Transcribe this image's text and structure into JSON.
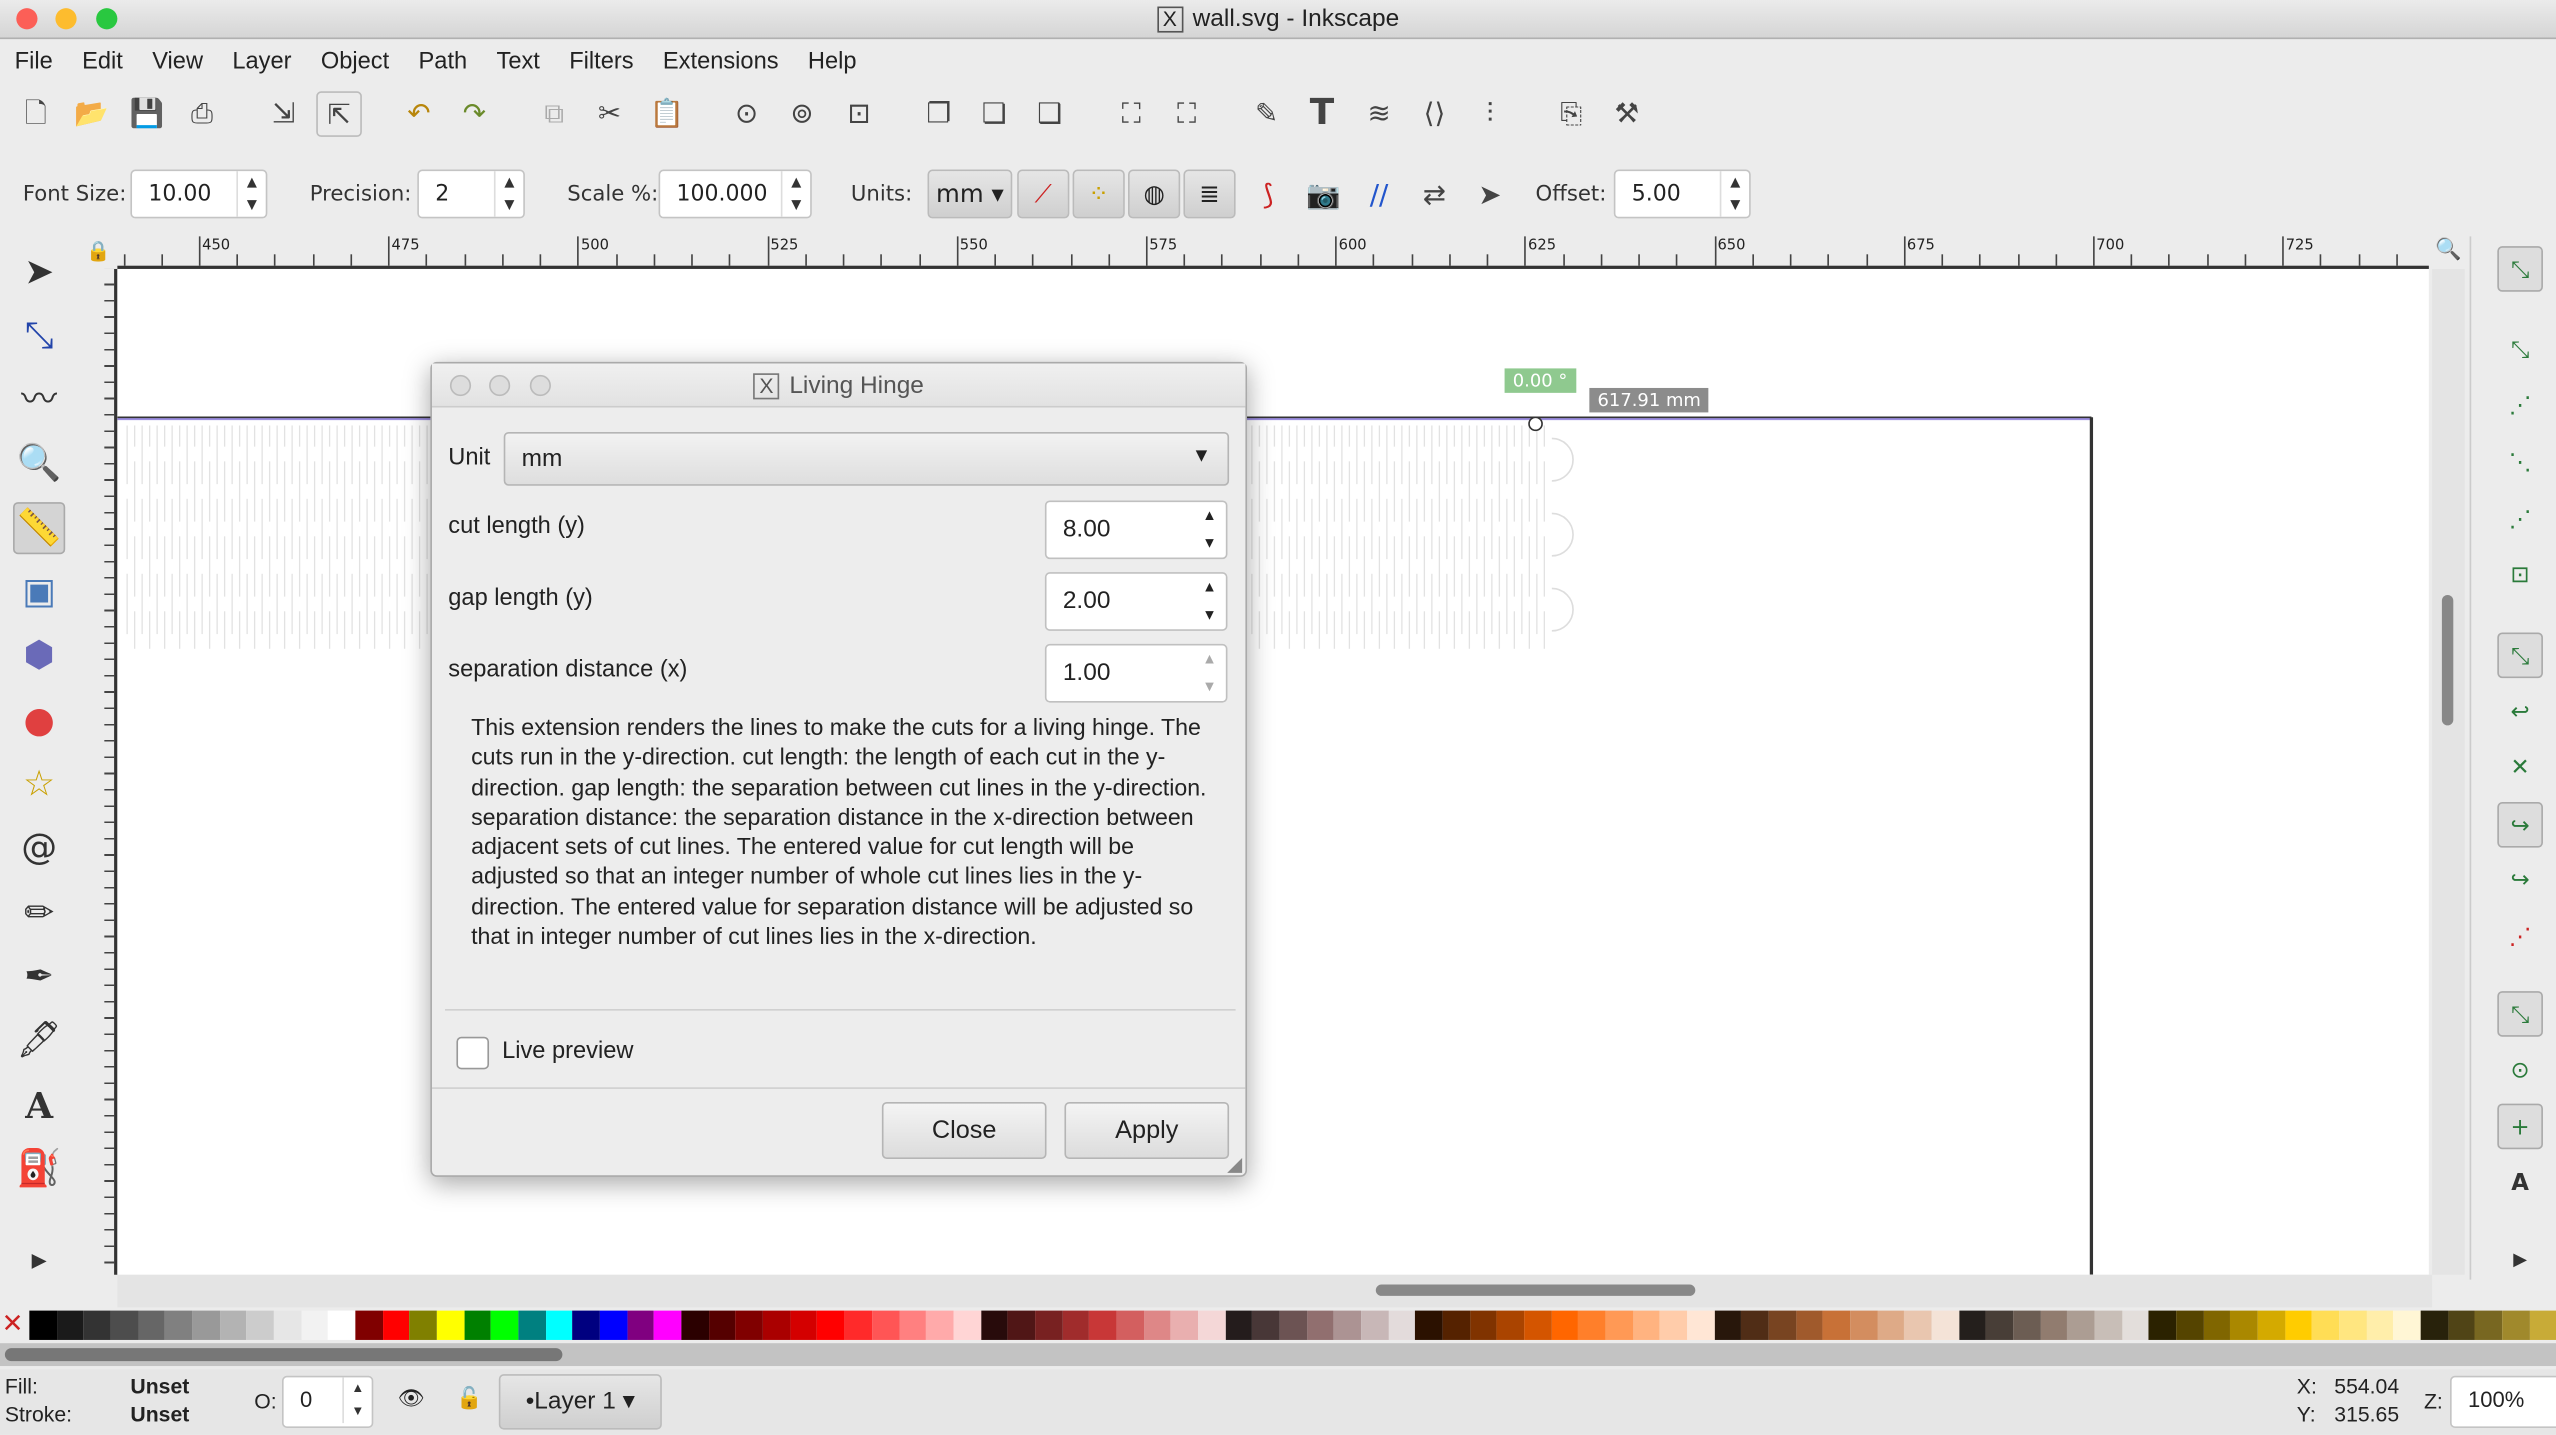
{
  "window": {
    "title": "wall.svg - Inkscape"
  },
  "menu": [
    "File",
    "Edit",
    "View",
    "Layer",
    "Object",
    "Path",
    "Text",
    "Filters",
    "Extensions",
    "Help"
  ],
  "controls": {
    "font_size_label": "Font Size:",
    "font_size": "10.00",
    "precision_label": "Precision:",
    "precision": "2",
    "scale_label": "Scale %:",
    "scale": "100.000",
    "units_label": "Units:",
    "units": "mm",
    "offset_label": "Offset:",
    "offset": "5.00"
  },
  "ruler": {
    "labels": [
      "450",
      "475",
      "500",
      "525",
      "550",
      "575",
      "600",
      "625",
      "650",
      "675",
      "700",
      "725"
    ]
  },
  "canvas": {
    "angle_label": "0.00 °",
    "length_label": "617.91 mm"
  },
  "dialog": {
    "title": "Living Hinge",
    "unit_label": "Unit",
    "unit": "mm",
    "fields": [
      {
        "label": "cut length (y)",
        "value": "8.00"
      },
      {
        "label": "gap length (y)",
        "value": "2.00"
      },
      {
        "label": "separation distance (x)",
        "value": "1.00"
      }
    ],
    "description": "This extension renders the lines to make the cuts for a living hinge. The cuts run in the y-direction. cut length: the length of each cut in the y-direction. gap length: the separation between cut lines in the y-direction. separation distance: the separation distance in the x-direction between adjacent sets of cut lines. The entered value for cut length will be adjusted so that an integer number of whole cut lines lies in the y-direction. The entered value for separation distance will be adjusted so that in integer number of cut lines lies in the x-direction.",
    "live_preview_label": "Live preview",
    "live_preview": false,
    "close_label": "Close",
    "apply_label": "Apply"
  },
  "status": {
    "fill_label": "Fill:",
    "fill": "Unset",
    "stroke_label": "Stroke:",
    "stroke": "Unset",
    "opacity_label": "O:",
    "opacity": "0",
    "layer": "•Layer 1",
    "x_label": "X:",
    "x": "554.04",
    "y_label": "Y:",
    "y": "315.65",
    "zoom_label": "Z:",
    "zoom": "100%"
  },
  "palette": [
    "#000000",
    "#1a1a1a",
    "#333333",
    "#4d4d4d",
    "#666666",
    "#808080",
    "#999999",
    "#b3b3b3",
    "#cccccc",
    "#e6e6e6",
    "#f2f2f2",
    "#ffffff",
    "#800000",
    "#ff0000",
    "#808000",
    "#ffff00",
    "#008000",
    "#00ff00",
    "#008080",
    "#00ffff",
    "#000080",
    "#0000ff",
    "#800080",
    "#ff00ff",
    "#2b0000",
    "#550000",
    "#800000",
    "#aa0000",
    "#d40000",
    "#ff0000",
    "#ff2a2a",
    "#ff5555",
    "#ff8080",
    "#ffaaaa",
    "#ffd5d5",
    "#280b0b",
    "#501616",
    "#782121",
    "#a02c2c",
    "#c83737",
    "#d35f5f",
    "#de8787",
    "#e9afaf",
    "#f4d7d7",
    "#241c1c",
    "#483737",
    "#6c5353",
    "#916f6f",
    "#ac9393",
    "#c8b7b7",
    "#e3dbdb",
    "#2b1100",
    "#552200",
    "#803300",
    "#aa4400",
    "#d45500",
    "#ff6600",
    "#ff7f2a",
    "#ff9955",
    "#ffb380",
    "#ffccaa",
    "#ffe6d5",
    "#28170b",
    "#502d16",
    "#784421",
    "#a05a2c",
    "#c87137",
    "#d38d5f",
    "#deaa87",
    "#e9c6af",
    "#f4e3d7",
    "#241f1c",
    "#483e37",
    "#6c5d53",
    "#917c6f",
    "#ac9d93",
    "#c8beb7",
    "#e3dedb",
    "#2b2200",
    "#554400",
    "#806600",
    "#aa8800",
    "#d4aa00",
    "#ffcc00",
    "#ffdd55",
    "#ffe680",
    "#ffeeaa",
    "#fff6d5",
    "#28220b",
    "#504416",
    "#786721",
    "#a0892c",
    "#c8ab37"
  ],
  "colors": {
    "angle_badge": "#8fc98f",
    "length_badge": "#8c8c8c",
    "guide_line": "#9c8ee0"
  }
}
